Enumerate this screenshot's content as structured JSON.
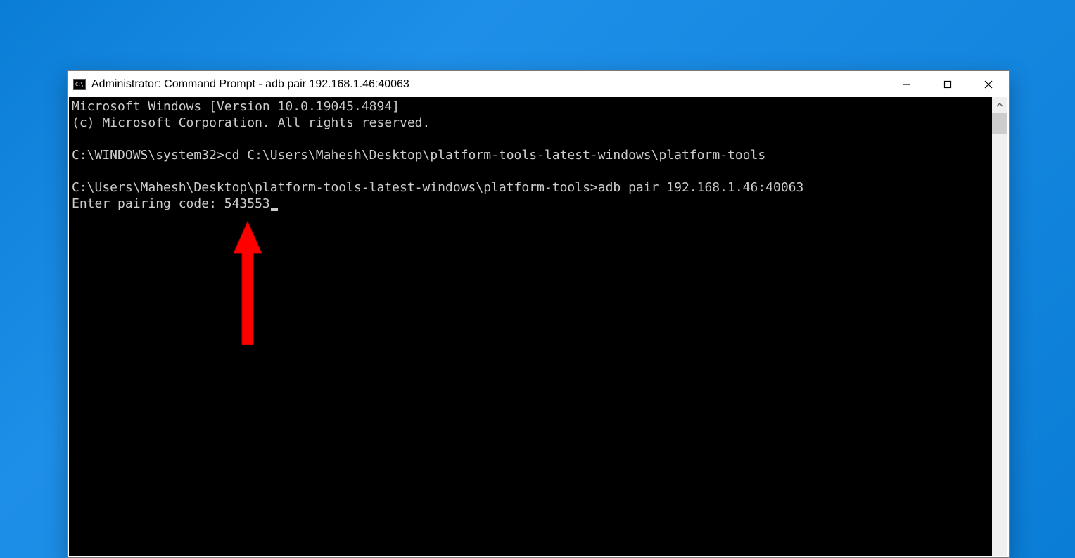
{
  "window": {
    "title": "Administrator: Command Prompt - adb  pair 192.168.1.46:40063"
  },
  "terminal": {
    "header_line1": "Microsoft Windows [Version 10.0.19045.4894]",
    "header_line2": "(c) Microsoft Corporation. All rights reserved.",
    "prompt1": "C:\\WINDOWS\\system32>",
    "command1": "cd C:\\Users\\Mahesh\\Desktop\\platform-tools-latest-windows\\platform-tools",
    "prompt2": "C:\\Users\\Mahesh\\Desktop\\platform-tools-latest-windows\\platform-tools>",
    "command2": "adb pair 192.168.1.46:40063",
    "pairing_label": "Enter pairing code: ",
    "pairing_code": "543553"
  }
}
